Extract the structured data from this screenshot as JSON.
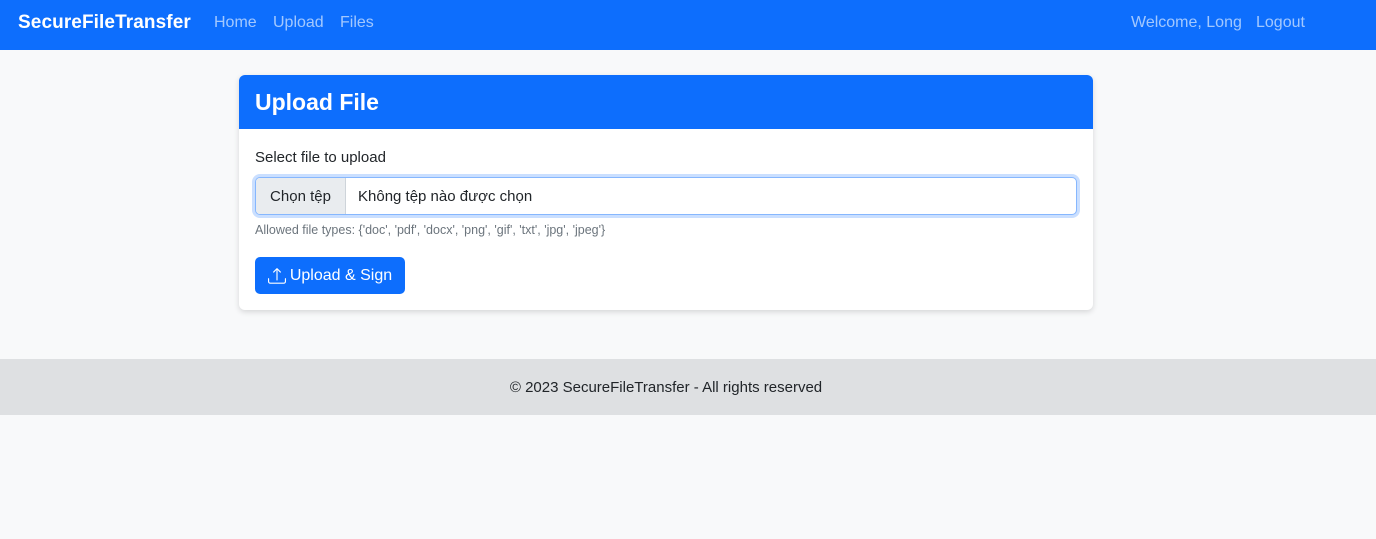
{
  "navbar": {
    "brand": "SecureFileTransfer",
    "links": [
      "Home",
      "Upload",
      "Files"
    ],
    "welcome": "Welcome, Long",
    "logout": "Logout"
  },
  "card": {
    "title": "Upload File",
    "label": "Select file to upload",
    "file_button": "Chọn tệp",
    "file_status": "Không tệp nào được chọn",
    "help_text": "Allowed file types: {'doc', 'pdf', 'docx', 'png', 'gif', 'txt', 'jpg', 'jpeg'}",
    "submit_label": "Upload & Sign",
    "submit_icon": "upload-icon"
  },
  "footer": {
    "text": "© 2023 SecureFileTransfer - All rights reserved"
  },
  "colors": {
    "primary": "#0d6efd",
    "background": "#f8f9fa",
    "footer_bg": "#dee0e2"
  }
}
